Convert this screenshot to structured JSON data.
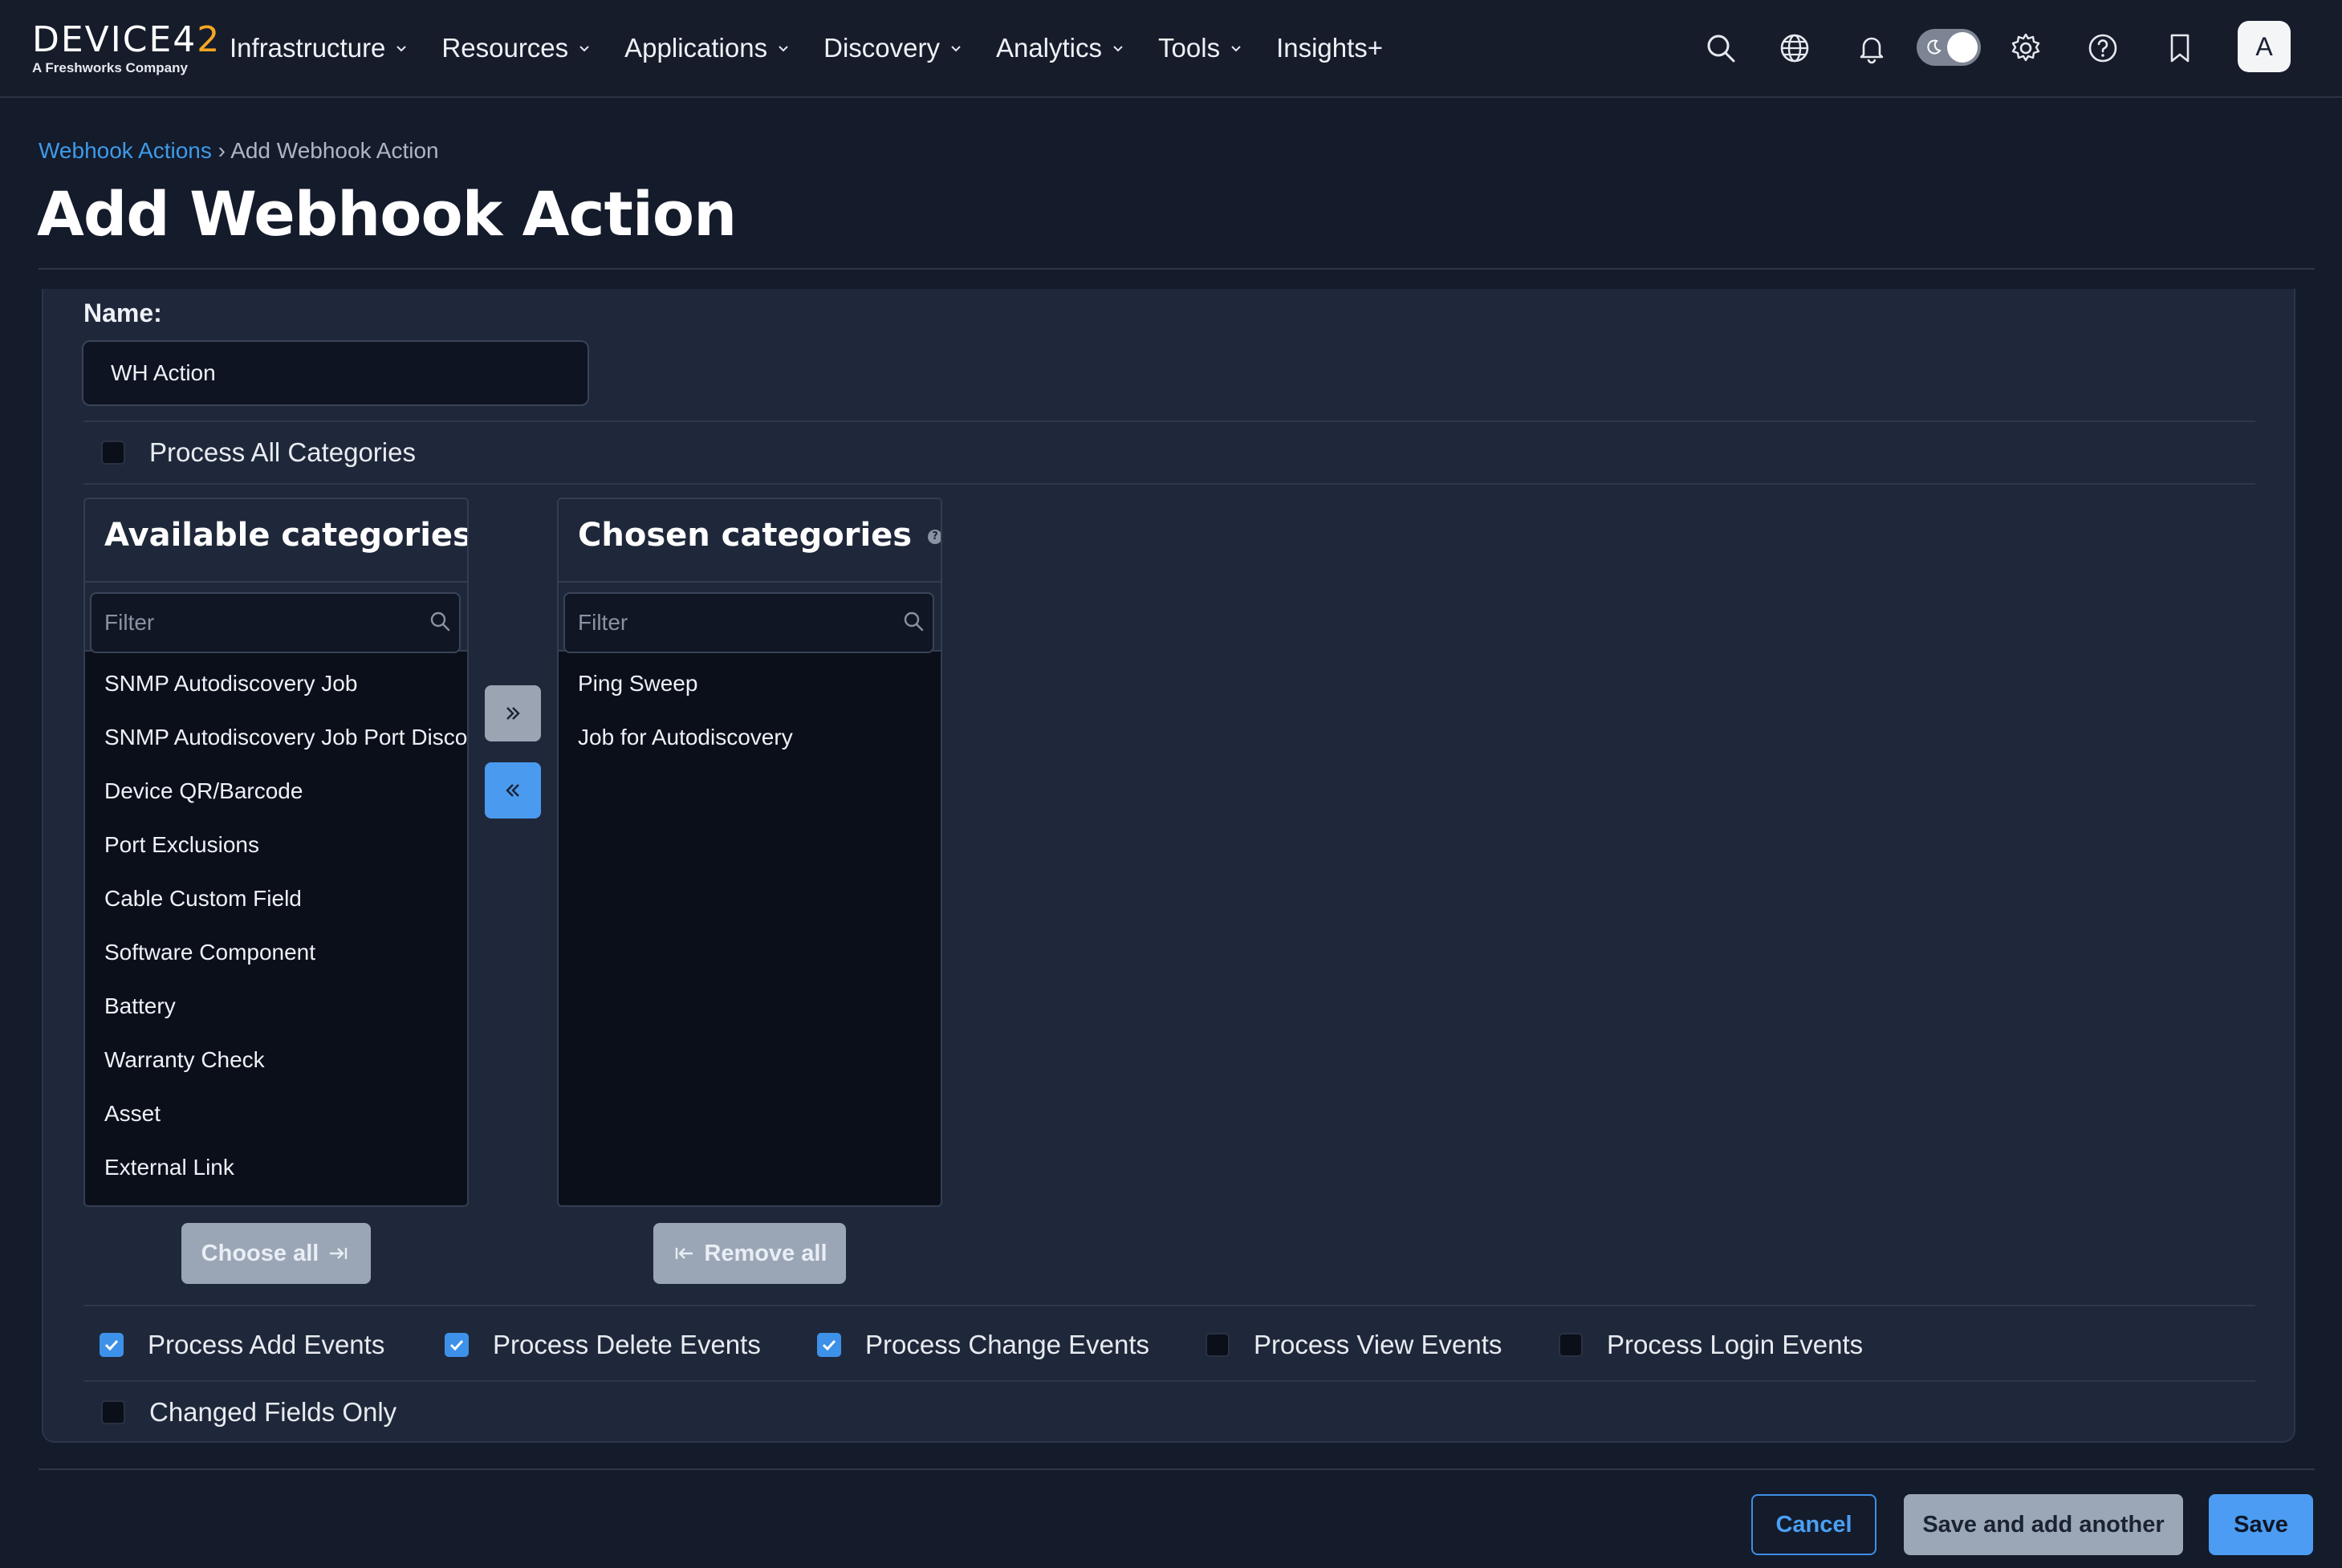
{
  "brand": {
    "logo_prefix": "DEVICE",
    "logo_number_a": "4",
    "logo_number_b": "2",
    "tagline": "A Freshworks Company"
  },
  "nav": {
    "items": [
      {
        "label": "Infrastructure",
        "has_dropdown": true
      },
      {
        "label": "Resources",
        "has_dropdown": true
      },
      {
        "label": "Applications",
        "has_dropdown": true
      },
      {
        "label": "Discovery",
        "has_dropdown": true
      },
      {
        "label": "Analytics",
        "has_dropdown": true
      },
      {
        "label": "Tools",
        "has_dropdown": true
      },
      {
        "label": "Insights+",
        "has_dropdown": false
      }
    ],
    "icons": [
      "search-icon",
      "globe-icon",
      "bell-icon",
      "theme-toggle",
      "gear-icon",
      "help-icon",
      "bookmark-icon"
    ],
    "theme_dark_mode": true,
    "avatar_initial": "A"
  },
  "breadcrumb": {
    "parent": "Webhook Actions",
    "separator": "›",
    "current": "Add Webhook Action"
  },
  "page_title": "Add Webhook Action",
  "form": {
    "name_label": "Name:",
    "name_value": "WH Action",
    "process_all_categories": {
      "label": "Process All Categories",
      "checked": false
    },
    "available": {
      "title": "Available categories",
      "filter_placeholder": "Filter",
      "items": [
        "SNMP Autodiscovery Job",
        "SNMP Autodiscovery Job Port Discovery",
        "Device QR/Barcode",
        "Port Exclusions",
        "Cable Custom Field",
        "Software Component",
        "Battery",
        "Warranty Check",
        "Asset",
        "External Link"
      ],
      "choose_all_label": "Choose all"
    },
    "chosen": {
      "title": "Chosen categories",
      "filter_placeholder": "Filter",
      "items": [
        "Ping Sweep",
        "Job for Autodiscovery"
      ],
      "remove_all_label": "Remove all"
    },
    "events": [
      {
        "label": "Process Add Events",
        "checked": true
      },
      {
        "label": "Process Delete Events",
        "checked": true
      },
      {
        "label": "Process Change Events",
        "checked": true
      },
      {
        "label": "Process View Events",
        "checked": false
      },
      {
        "label": "Process Login Events",
        "checked": false
      }
    ],
    "changed_fields_only": {
      "label": "Changed Fields Only",
      "checked": false
    }
  },
  "footer": {
    "cancel_label": "Cancel",
    "save_another_label": "Save and add another",
    "save_label": "Save"
  },
  "colors": {
    "background": "#141b2b",
    "panel": "#1f283a",
    "accent_blue": "#4b9cf2",
    "logo_accent": "#f5a623",
    "list_bg": "#0b0f19"
  }
}
